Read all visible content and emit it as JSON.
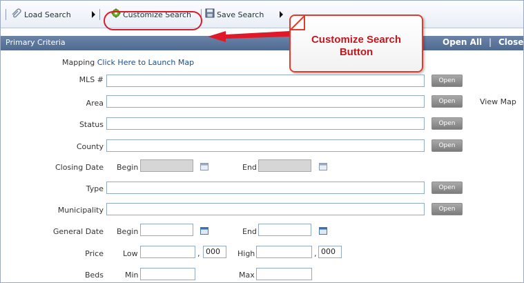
{
  "toolbar": {
    "load_search": "Load Search",
    "customize_search": "Customize Search",
    "save_search": "Save Search"
  },
  "callout": {
    "line1": "Customize Search",
    "line2": "Button"
  },
  "section": {
    "title": "Primary Criteria",
    "open_all": "Open All",
    "divider": "|",
    "close_all": "Close"
  },
  "mapping": {
    "label": "Mapping",
    "link": "Click Here to Launch Map"
  },
  "fields": {
    "mls": {
      "label": "MLS #",
      "button": "Open"
    },
    "area": {
      "label": "Area",
      "button": "Open",
      "view_map": "View Map"
    },
    "status": {
      "label": "Status",
      "button": "Open"
    },
    "county": {
      "label": "County",
      "button": "Open"
    },
    "closing_date": {
      "label": "Closing Date",
      "begin": "Begin",
      "end": "End"
    },
    "type": {
      "label": "Type",
      "button": "Open"
    },
    "municipality": {
      "label": "Municipality",
      "button": "Open"
    },
    "general_date": {
      "label": "General Date",
      "begin": "Begin",
      "end": "End"
    },
    "price": {
      "label": "Price",
      "low": "Low",
      "high": "High",
      "suffix_low": "000",
      "suffix_high": "000",
      "comma": ","
    },
    "beds": {
      "label": "Beds",
      "min": "Min",
      "max": "Max"
    }
  },
  "colors": {
    "accent_red": "#e0192a",
    "header_blue": "#5a7399",
    "link_blue": "#1a4d8c"
  }
}
